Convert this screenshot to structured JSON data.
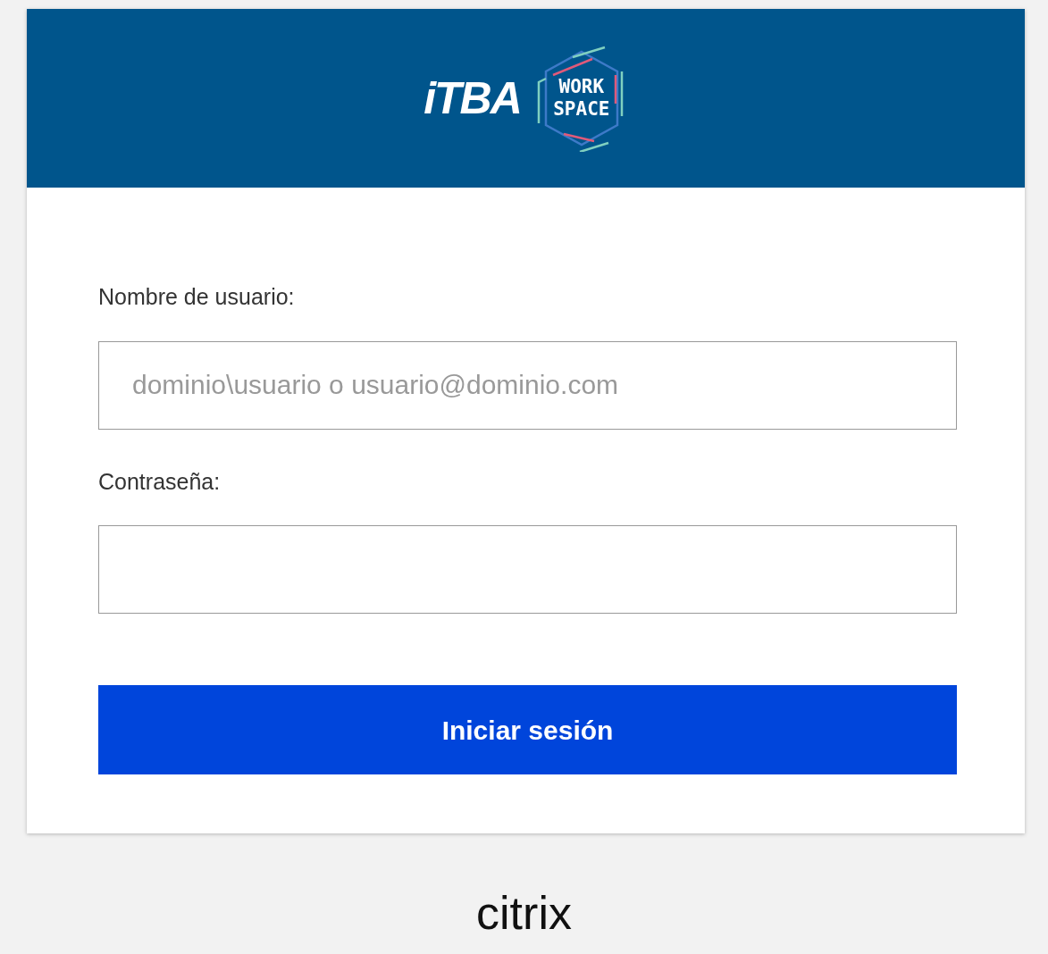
{
  "header": {
    "logo_text": "iTBA",
    "badge_lines": [
      "WORK",
      "SPACE"
    ]
  },
  "fields": [
    {
      "label": "Nombre de usuario:",
      "placeholder": "dominio\\usuario o usuario@dominio.com"
    },
    {
      "label": "Contraseña:"
    }
  ],
  "submit": {
    "label": "Iniciar sesión"
  },
  "footer": {
    "brand": "citrix"
  }
}
